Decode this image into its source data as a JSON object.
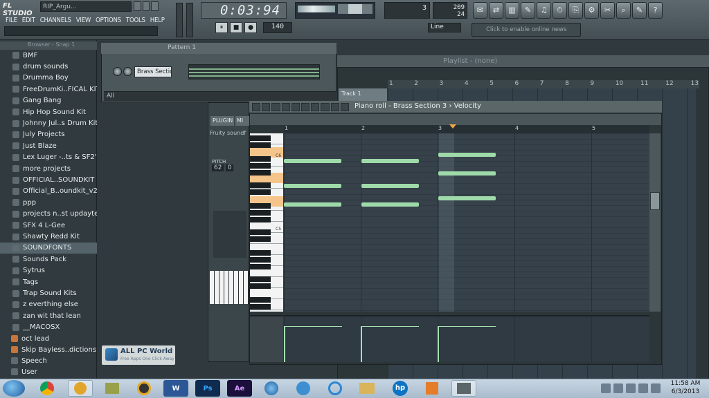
{
  "app": {
    "logo": "FL STUDIO",
    "hint": "RIP_Argu...",
    "menu": [
      "FILE",
      "EDIT",
      "CHANNELS",
      "VIEW",
      "OPTIONS",
      "TOOLS",
      "HELP"
    ],
    "time": "0:03:94",
    "bpm": "140",
    "pattern_number": "3",
    "memory_line1": "209",
    "memory_line2": "24",
    "snap": "Line",
    "news": "Click to enable online news",
    "toolbar_glyphs": [
      "✉",
      "⇄",
      "▥",
      "✎",
      "♫",
      "⏱",
      "⎘",
      "⚙",
      "✂",
      "⌕",
      "✎",
      "?"
    ],
    "play_buttons": [
      "⏸",
      "■",
      "●"
    ]
  },
  "browser": {
    "title": "Browser - Snap 1",
    "items": [
      {
        "label": "BMF",
        "selected": false
      },
      {
        "label": "drum sounds",
        "selected": false
      },
      {
        "label": "Drumma Boy",
        "selected": false
      },
      {
        "label": "FreeDrumKi..FICAL KIT",
        "selected": false
      },
      {
        "label": "Gang Bang",
        "selected": false
      },
      {
        "label": "Hip Hop Sound Kit",
        "selected": false
      },
      {
        "label": "Johnny Jul..s Drum Kit",
        "selected": false
      },
      {
        "label": "July Projects",
        "selected": false
      },
      {
        "label": "Just Blaze",
        "selected": false
      },
      {
        "label": "Lex Luger -..ts & SF2's",
        "selected": false
      },
      {
        "label": "more projects",
        "selected": false
      },
      {
        "label": "OFFICIAL..SOUNDKIT",
        "selected": false
      },
      {
        "label": "Official_B..oundkit_v2",
        "selected": false
      },
      {
        "label": "ppp",
        "selected": false
      },
      {
        "label": "projects n..st updayte",
        "selected": false
      },
      {
        "label": "SFX 4 L-Gee",
        "selected": false
      },
      {
        "label": "Shawty Redd Kit",
        "selected": false
      },
      {
        "label": "SOUNDFONTS",
        "selected": true
      },
      {
        "label": "Sounds Pack",
        "selected": false
      },
      {
        "label": "Sytrus",
        "selected": false
      },
      {
        "label": "Tags",
        "selected": false
      },
      {
        "label": "Trap Sound Kits",
        "selected": false
      },
      {
        "label": "z everthing else",
        "selected": false
      },
      {
        "label": "zan wit that lean",
        "selected": false
      },
      {
        "label": "__MACOSX",
        "selected": false
      }
    ],
    "files": [
      "oct lead",
      "Skip Bayless..dictions 2012",
      "Speech",
      "User"
    ]
  },
  "pattern": {
    "title": "Pattern 1",
    "channel": "Brass Section 3",
    "filter": "All"
  },
  "plugin": {
    "tab_plugin": "PLUGIN",
    "tab_misc": "MI",
    "name": "Fruity soundf",
    "pitch_label": "PITCH",
    "pitch_value": "62",
    "pitch_value2": "0"
  },
  "playlist": {
    "title": "Playlist - (none)",
    "track": "Track 1",
    "bar_numbers": [
      "1",
      "2",
      "3",
      "4",
      "5",
      "6",
      "7",
      "8",
      "9",
      "10",
      "11",
      "12",
      "13"
    ]
  },
  "piano_roll": {
    "title": "Piano roll - Brass Section 3",
    "view": "Velocity",
    "bar_numbers": [
      "1",
      "2",
      "3",
      "4",
      "5"
    ],
    "key_labels": [
      "C6",
      "C5"
    ]
  },
  "watermark": {
    "title": "ALL PC World",
    "subtitle": "Free Apps One Click Away"
  },
  "taskbar": {
    "time": "11:58 AM",
    "date": "6/3/2013",
    "apps": [
      "W",
      "Ps",
      "Ae",
      "hp"
    ]
  }
}
